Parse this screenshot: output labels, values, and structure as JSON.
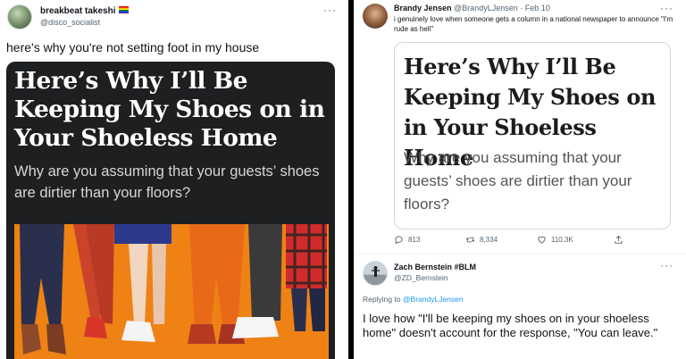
{
  "left_tweet": {
    "author_name": "breakbeat takeshi",
    "handle": "@disco_socialist",
    "more_label": "···",
    "text": "here's why you're not setting foot in my house",
    "card": {
      "headline": "Here’s Why I’ll Be Keeping My Shoes on in Your Shoeless Home",
      "subhead": "Why are you assuming that your guests’ shoes are dirtier than your floors?"
    }
  },
  "right_tweet": {
    "author_name": "Brandy Jensen",
    "handle": "@BrandyLJensen",
    "separator": "·",
    "date": "Feb 10",
    "more_label": "···",
    "text": "i genuinely love when someone gets a column in a national newspaper to announce \"I'm rude as hell\"",
    "card": {
      "headline": "Here’s Why I’ll Be Keeping My Shoes on in Your Shoeless Home",
      "subhead": "Why are you assuming that your guests’ shoes are dirtier than your floors?"
    },
    "actions": {
      "replies": "813",
      "retweets": "8,334",
      "likes": "110.3K"
    }
  },
  "reply_tweet": {
    "author_name": "Zach Bernstein #BLM",
    "handle": "@ZD_Bernstein",
    "more_label": "···",
    "replying_prefix": "Replying to",
    "replying_to": "@BrandyLJensen",
    "text": "I love how \"I'll be keeping my shoes on in your shoeless home\" doesn't account for the response, \"You can leave.\""
  },
  "colors": {
    "link": "#1d9bf0",
    "secondary_text": "#536471",
    "card_dark": "#1d1f21"
  },
  "icons": [
    "reply-icon",
    "retweet-icon",
    "like-icon",
    "share-icon",
    "pride-flag-icon",
    "more-icon"
  ]
}
